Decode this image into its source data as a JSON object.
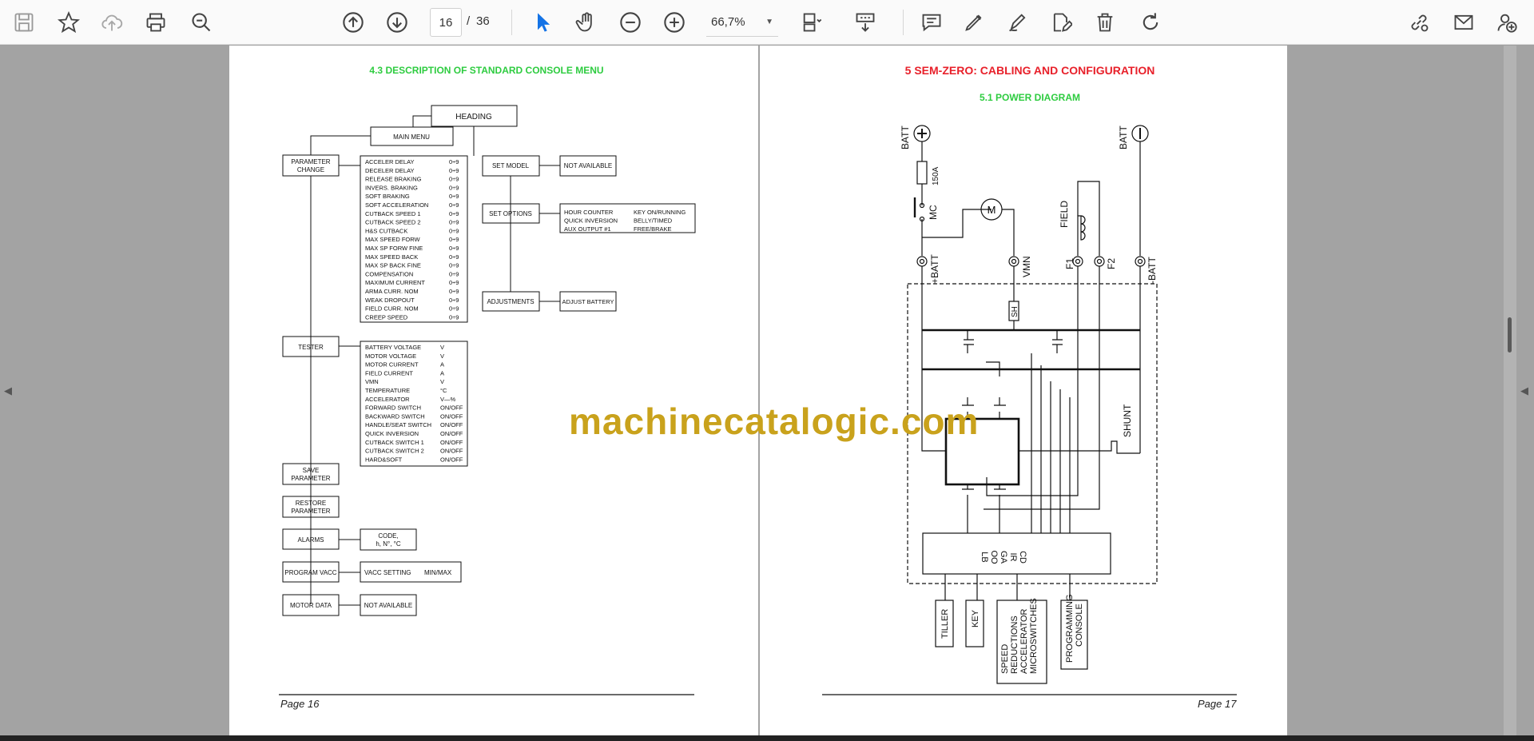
{
  "toolbar": {
    "current_page": "16",
    "page_separator": "/",
    "total_pages": "36",
    "zoom": "66,7%",
    "icons": [
      "save-icon",
      "bookmark-star-icon",
      "cloud-upload-icon",
      "print-icon",
      "zoom-find-icon",
      "page-up-icon",
      "page-down-icon",
      "select-cursor-icon",
      "hand-tool-icon",
      "zoom-out-icon",
      "zoom-in-icon",
      "fit-page-icon",
      "scroll-mode-icon",
      "comment-icon",
      "highlight-pen-icon",
      "draw-icon",
      "edit-pdf-icon",
      "delete-icon",
      "rotate-icon",
      "share-link-icon",
      "email-icon",
      "add-user-icon"
    ]
  },
  "left_page": {
    "title": "4.3 DESCRIPTION OF STANDARD CONSOLE MENU",
    "page_label": "Page 16",
    "nodes": {
      "heading": "HEADING",
      "main_menu": "MAIN MENU",
      "parameter_change": [
        "PARAMETER",
        "CHANGE"
      ],
      "set_model": "SET MODEL",
      "not_available_1": "NOT AVAILABLE",
      "set_options": "SET OPTIONS",
      "adjustments": "ADJUSTMENTS",
      "adjust_battery": "ADJUST BATTERY",
      "tester": "TESTER",
      "save_parameter": [
        "SAVE",
        "PARAMETER"
      ],
      "restore_parameter": [
        "RESTORE",
        "PARAMETER"
      ],
      "alarms": "ALARMS",
      "alarm_code": [
        "CODE,",
        "h,  N°,  °C"
      ],
      "program_vacc": "PROGRAM VACC",
      "vacc_setting": "VACC SETTING",
      "min_max": "MIN/MAX",
      "motor_data": "MOTOR DATA",
      "not_available_2": "NOT AVAILABLE"
    },
    "parameter_list": [
      [
        "ACCELER DELAY",
        "0÷9"
      ],
      [
        "DECELER DELAY",
        "0÷9"
      ],
      [
        "RELEASE BRAKING",
        "0÷9"
      ],
      [
        "INVERS. BRAKING",
        "0÷9"
      ],
      [
        "SOFT BRAKING",
        "0÷9"
      ],
      [
        "SOFT ACCELERATION",
        "0÷9"
      ],
      [
        "CUTBACK SPEED 1",
        "0÷9"
      ],
      [
        "CUTBACK SPEED 2",
        "0÷9"
      ],
      [
        "H&S CUTBACK",
        "0÷9"
      ],
      [
        "MAX SPEED FORW",
        "0÷9"
      ],
      [
        "MAX SP FORW FINE",
        "0÷9"
      ],
      [
        "MAX SPEED BACK",
        "0÷9"
      ],
      [
        "MAX SP BACK FINE",
        "0÷9"
      ],
      [
        "COMPENSATION",
        "0÷9"
      ],
      [
        "MAXIMUM CURRENT",
        "0÷9"
      ],
      [
        "ARMA CURR. NOM",
        "0÷9"
      ],
      [
        "WEAK DROPOUT",
        "0÷9"
      ],
      [
        "FIELD CURR. NOM",
        "0÷9"
      ],
      [
        "CREEP SPEED",
        "0÷9"
      ]
    ],
    "options_list": [
      [
        "HOUR COUNTER",
        "KEY ON/RUNNING"
      ],
      [
        "QUICK INVERSION",
        "BELLY/TIMED"
      ],
      [
        "AUX OUTPUT #1",
        "FREE/BRAKE"
      ]
    ],
    "tester_list": [
      [
        "BATTERY VOLTAGE",
        "V"
      ],
      [
        "MOTOR VOLTAGE",
        "V"
      ],
      [
        "MOTOR CURRENT",
        "A"
      ],
      [
        "FIELD CURRENT",
        "A"
      ],
      [
        "VMN",
        "V"
      ],
      [
        "TEMPERATURE",
        "°C"
      ],
      [
        "ACCELERATOR",
        "V—%"
      ],
      [
        "FORWARD SWITCH",
        "ON/OFF"
      ],
      [
        "BACKWARD SWITCH",
        "ON/OFF"
      ],
      [
        "HANDLE/SEAT SWITCH",
        "ON/OFF"
      ],
      [
        "QUICK INVERSION",
        "ON/OFF"
      ],
      [
        "CUTBACK SWITCH 1",
        "ON/OFF"
      ],
      [
        "CUTBACK SWITCH 2",
        "ON/OFF"
      ],
      [
        "HARD&SOFT",
        "ON/OFF"
      ]
    ]
  },
  "right_page": {
    "title": "5 SEM-ZERO: CABLING AND CONFIGURATION",
    "subtitle": "5.1 POWER DIAGRAM",
    "page_label": "Page 17",
    "labels": {
      "batt_pos": "BATT",
      "fuse": "150A",
      "mc": "MC",
      "motor": "M",
      "field": "FIELD",
      "batt_neg": "BATT",
      "t_batt_pos": "+BATT",
      "t_vmn": "VMN",
      "t_f1": "F1",
      "t_f2": "F2",
      "t_batt_neg": "-BATT",
      "sh": "SH",
      "shunt": "SHUNT",
      "logic_lines": [
        "LB",
        "OO",
        "GA",
        "IR",
        "CD"
      ],
      "tiller": "TILLER",
      "key": "KEY",
      "speed_lines": [
        "SPEED",
        "REDUCTIONS",
        "ACCELERATOR",
        "MICROSWITCHES"
      ],
      "console_lines": [
        "PROGRAMMING",
        "CONSOLE"
      ]
    }
  },
  "watermark": "machinecatalogic.com",
  "colors": {
    "heading_green": "#2ecc40",
    "heading_red": "#e8202a",
    "watermark": "#c9a21c",
    "viewer_bg": "#a3a3a3"
  }
}
